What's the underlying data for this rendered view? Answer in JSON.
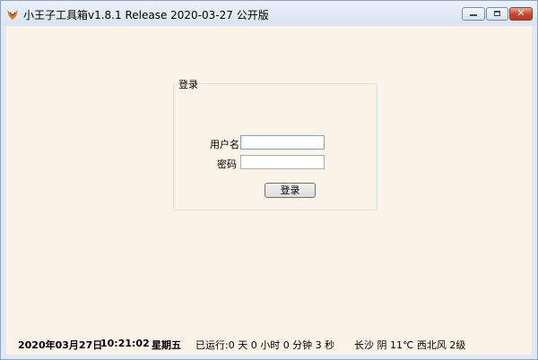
{
  "window": {
    "title": "小王子工具箱v1.8.1 Release 2020-03-27 公开版",
    "app_icon": "fox-logo-icon",
    "controls": {
      "minimize": "minimize-icon",
      "maximize": "maximize-icon",
      "close_glyph": "✕"
    }
  },
  "login": {
    "group_title": "登录",
    "username_label": "用户名",
    "username_value": "",
    "password_label": "密码",
    "password_value": "",
    "submit_label": "登录"
  },
  "status": {
    "date": "2020年03月27日",
    "time": "10:21:02",
    "weekday": "星期五",
    "uptime": "已运行:0 天 0 小时 0 分钟 3 秒",
    "weather": "长沙 阴 11℃ 西北风 2级"
  },
  "colors": {
    "client_background": "#fbf3e7",
    "titlebar": "#dae4f1",
    "close_button": "#c8482f"
  }
}
